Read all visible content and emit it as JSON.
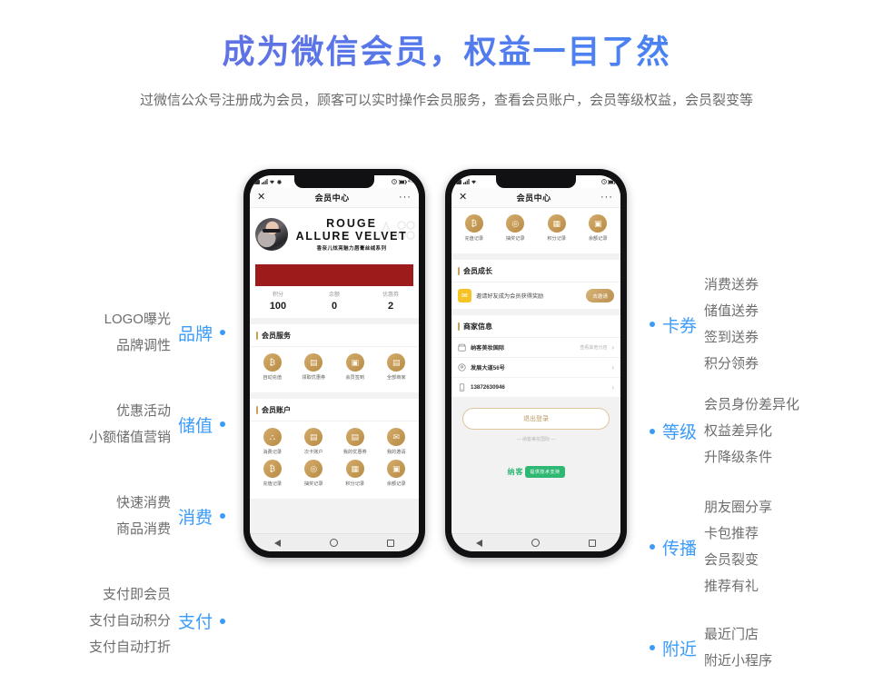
{
  "header": {
    "title": "成为微信会员，权益一目了然",
    "subtitle": "过微信公众号注册成为会员，顾客可以实时操作会员服务，查看会员账户，会员等级权益，会员裂变等",
    "title_gradient_from": "#6f6fdd",
    "title_gradient_to": "#4a86f5",
    "accent_blue": "#3b9bfb"
  },
  "left_annotations": [
    {
      "key": "品牌",
      "lines": [
        "LOGO曝光",
        "品牌调性"
      ]
    },
    {
      "key": "储值",
      "lines": [
        "优惠活动",
        "小额储值营销"
      ]
    },
    {
      "key": "消费",
      "lines": [
        "快速消费",
        "商品消费"
      ]
    },
    {
      "key": "支付",
      "lines": [
        "支付即会员",
        "支付自动积分",
        "支付自动打折"
      ]
    }
  ],
  "right_annotations": [
    {
      "key": "卡券",
      "lines": [
        "消费送券",
        "储值送券",
        "签到送券",
        "积分领券"
      ]
    },
    {
      "key": "等级",
      "lines": [
        "会员身份差异化",
        "权益差异化",
        "升降级条件"
      ]
    },
    {
      "key": "传播",
      "lines": [
        "朋友圈分享",
        "卡包推荐",
        "会员裂变",
        "推荐有礼"
      ]
    },
    {
      "key": "附近",
      "lines": [
        "最近门店",
        "附近小程序"
      ]
    }
  ],
  "phone_left": {
    "statusbar": {
      "time": "",
      "battery": "4.0"
    },
    "navbar": {
      "close": "✕",
      "title": "会员中心",
      "more": "···"
    },
    "banner": {
      "line1": "ROUGE",
      "line2": "ALLURE VELVET",
      "subtitle": "香奈儿炫亮魅力唇膏丝绒系列",
      "bar_color": "#9e1b1b"
    },
    "stats": [
      {
        "label": "积分",
        "value": "100"
      },
      {
        "label": "余额",
        "value": "0"
      },
      {
        "label": "优惠券",
        "value": "2"
      }
    ],
    "service_section": {
      "title": "会员服务",
      "items": [
        {
          "label": "自动充值",
          "icon": "money-bag-icon",
          "glyph": "₿"
        },
        {
          "label": "领取优惠券",
          "icon": "coupon-icon",
          "glyph": "▤"
        },
        {
          "label": "会员签到",
          "icon": "calendar-icon",
          "glyph": "▣"
        },
        {
          "label": "全部商家",
          "icon": "shop-icon",
          "glyph": "▤"
        }
      ]
    },
    "account_section": {
      "title": "会员账户",
      "items": [
        {
          "label": "消费记录",
          "icon": "cart-icon",
          "glyph": "⛬"
        },
        {
          "label": "次卡账户",
          "icon": "card-icon",
          "glyph": "▤"
        },
        {
          "label": "我的优惠券",
          "icon": "ticket-icon",
          "glyph": "▤"
        },
        {
          "label": "我的邀请",
          "icon": "envelope-icon",
          "glyph": "✉"
        },
        {
          "label": "充值记录",
          "icon": "money-bag-icon",
          "glyph": "₿"
        },
        {
          "label": "抽奖记录",
          "icon": "lottery-icon",
          "glyph": "◎"
        },
        {
          "label": "积分记录",
          "icon": "points-icon",
          "glyph": "▦"
        },
        {
          "label": "余额记录",
          "icon": "balance-icon",
          "glyph": "▣"
        }
      ]
    },
    "bottom_nav": [
      "back-triangle",
      "home-circle",
      "recents-square"
    ]
  },
  "phone_right": {
    "navbar": {
      "close": "✕",
      "title": "会员中心",
      "more": "···"
    },
    "top_items": [
      {
        "label": "充值记录",
        "icon": "money-bag-icon",
        "glyph": "₿"
      },
      {
        "label": "抽奖记录",
        "icon": "lottery-icon",
        "glyph": "◎"
      },
      {
        "label": "积分记录",
        "icon": "points-icon",
        "glyph": "▦"
      },
      {
        "label": "余额记录",
        "icon": "balance-icon",
        "glyph": "▣"
      }
    ],
    "growth_section": {
      "title": "会员成长",
      "text": "邀请好友成为会员获得奖励",
      "button": "去邀请"
    },
    "merchant_section": {
      "title": "商家信息",
      "rows": [
        {
          "icon": "shop-icon",
          "text": "纳客美妆国际",
          "extra": "查看其他分店"
        },
        {
          "icon": "location-pin-icon",
          "text": "发展大道56号",
          "extra": ""
        },
        {
          "icon": "phone-icon",
          "text": "13872630946",
          "extra": ""
        }
      ]
    },
    "logout_button": "退出登录",
    "brand_footer": "— 纳客美妆国际 —",
    "powered_by": {
      "brand": "纳客",
      "tag": "提供技术支持",
      "color": "#2fb873"
    }
  }
}
